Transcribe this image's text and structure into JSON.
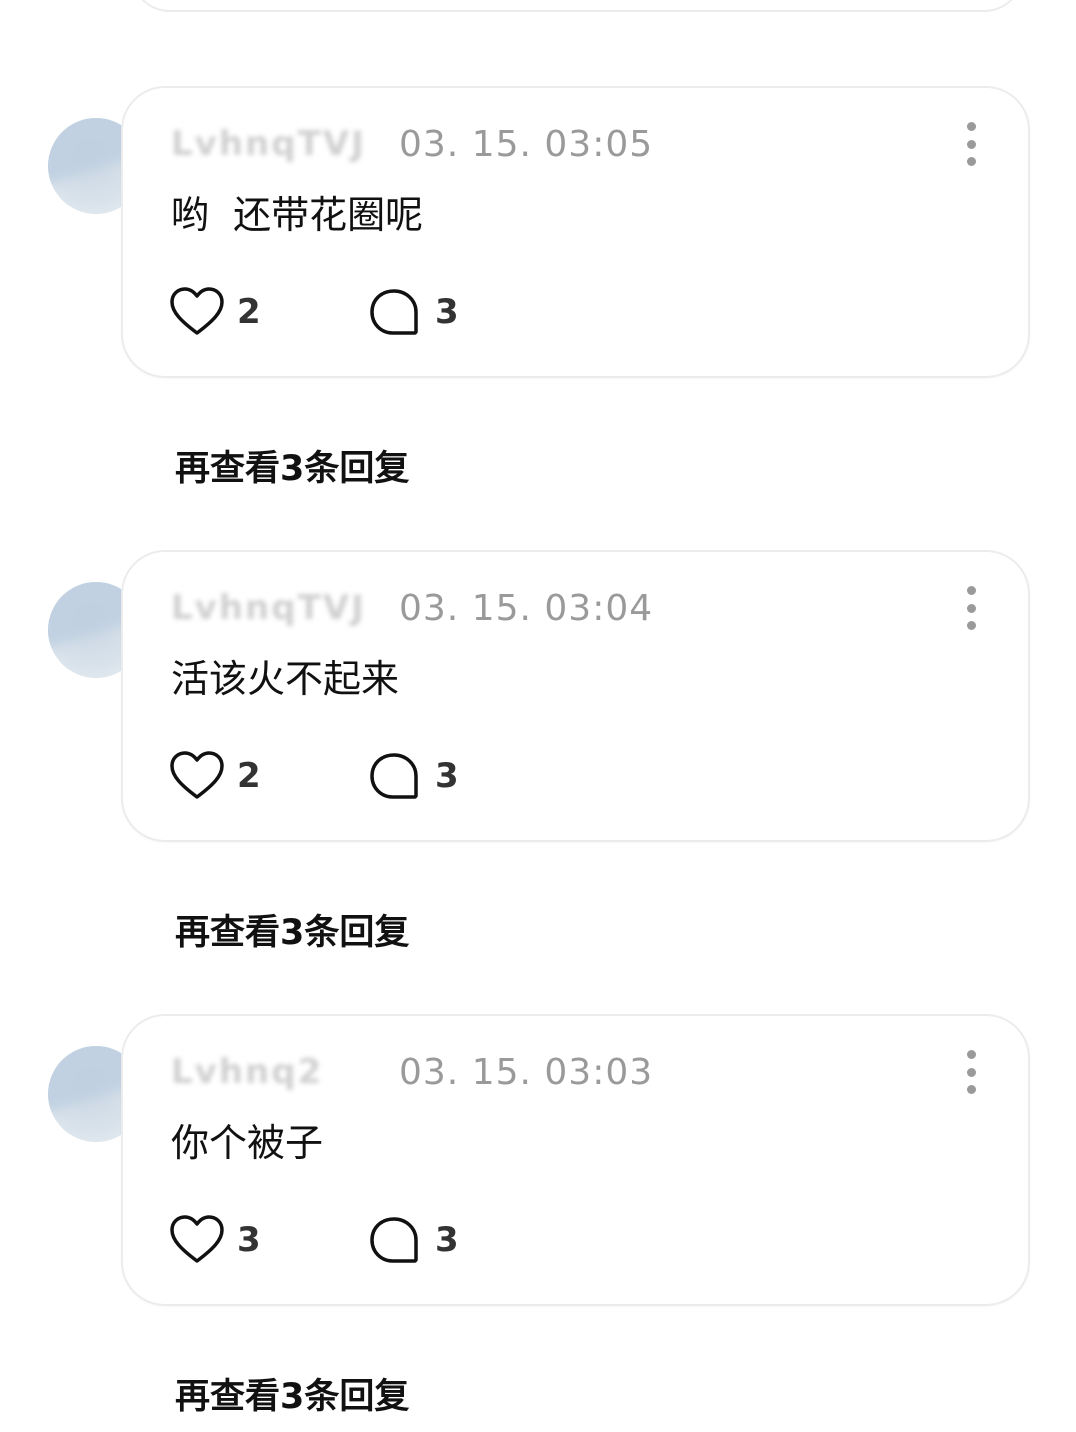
{
  "comments": [
    {
      "username": "LvhnqTVJ",
      "timestamp": "03. 15. 03:05",
      "text": "哟  还带花圈呢",
      "likes": "2",
      "replies": "3",
      "more_replies_label": "再查看3条回复"
    },
    {
      "username": "LvhnqTVJ",
      "timestamp": "03. 15. 03:04",
      "text": "活该火不起来",
      "likes": "2",
      "replies": "3",
      "more_replies_label": "再查看3条回复"
    },
    {
      "username": "Lvhnq2",
      "timestamp": "03. 15. 03:03",
      "text": "你个被子",
      "likes": "3",
      "replies": "3",
      "more_replies_label": "再查看3条回复"
    }
  ],
  "icons": {
    "like": "heart-icon",
    "reply": "speech-bubble-icon",
    "more": "vertical-dots-icon"
  },
  "colors": {
    "timestamp": "#9a9a9a",
    "card_border": "#ececec",
    "text": "#111111"
  }
}
